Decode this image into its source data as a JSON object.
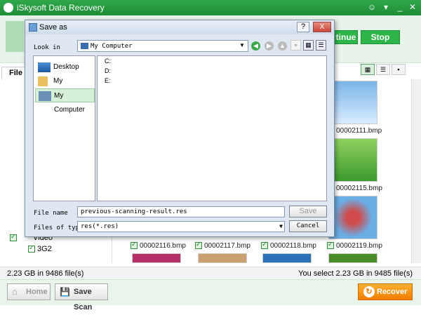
{
  "app": {
    "title": "iSkysoft Data Recovery",
    "header_buttons": {
      "continue": "tinue",
      "stop": "Stop"
    },
    "tab_file": "File T",
    "left_tree": {
      "video": "Video",
      "3g2": "3G2"
    },
    "thumbs": [
      "00002111.bmp",
      "00002115.bmp",
      "00002116.bmp",
      "00002117.bmp",
      "00002118.bmp",
      "00002119.bmp"
    ],
    "status": {
      "left": "2.23 GB in 9486 file(s)",
      "right": "You select 2.23 GB in 9485 file(s)"
    },
    "bottom": {
      "home": "Home",
      "save_scan": "Save Scan",
      "recover": "Recover"
    },
    "colors": {
      "green": "#2eb54a",
      "orange": "#f07c00"
    }
  },
  "dialog": {
    "title": "Save as",
    "help": "?",
    "close": "X",
    "look_in_label": "Look in",
    "look_in_value": "My Computer",
    "places": [
      {
        "label": "Desktop",
        "icon": "desktop-icon"
      },
      {
        "label": "My Documents",
        "icon": "folder-icon"
      },
      {
        "label": "My Computer",
        "icon": "computer-icon",
        "selected": true
      }
    ],
    "drives": [
      "C:",
      "D:",
      "E:"
    ],
    "file_name_label": "File name",
    "file_name_value": "previous-scanning-result.res",
    "files_of_type_label": "Files of type",
    "files_of_type_value": "res(*.res)",
    "save_button": "Save",
    "cancel_button": "Cancel"
  }
}
